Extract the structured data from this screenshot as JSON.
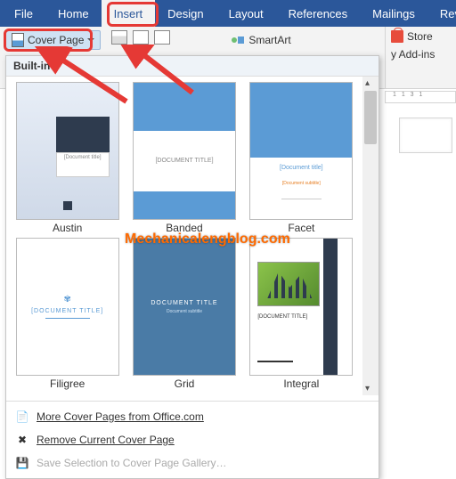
{
  "tabs": {
    "file": "File",
    "home": "Home",
    "insert": "Insert",
    "design": "Design",
    "layout": "Layout",
    "references": "References",
    "mailings": "Mailings",
    "review": "Revie"
  },
  "cover_page": {
    "label": "Cover Page"
  },
  "smartart": {
    "label": "SmartArt"
  },
  "store": {
    "label": "Store"
  },
  "addins": {
    "header": "y Add-ins",
    "body": "Add-ins"
  },
  "dropdown": {
    "header": "Built-in",
    "thumbs": {
      "austin": {
        "label": "Austin",
        "txt": "[Document title]"
      },
      "banded": {
        "label": "Banded",
        "txt": "[DOCUMENT TITLE]"
      },
      "facet": {
        "label": "Facet",
        "txt": "[Document title]",
        "sub": "[Document subtitle]"
      },
      "filigree": {
        "label": "Filigree",
        "txt": "[DOCUMENT TITLE]"
      },
      "grid": {
        "label": "Grid",
        "txt": "DOCUMENT TITLE",
        "sub": "Document subtitle"
      },
      "integral": {
        "label": "Integral",
        "txt": "[DOCUMENT TITLE]"
      }
    },
    "footer": {
      "more": "More Cover Pages from Office.com",
      "remove": "Remove Current Cover Page",
      "save": "Save Selection to Cover Page Gallery…"
    }
  },
  "rulers_text": "1  1  3  1",
  "watermark": "Mechanicalengblog.com"
}
